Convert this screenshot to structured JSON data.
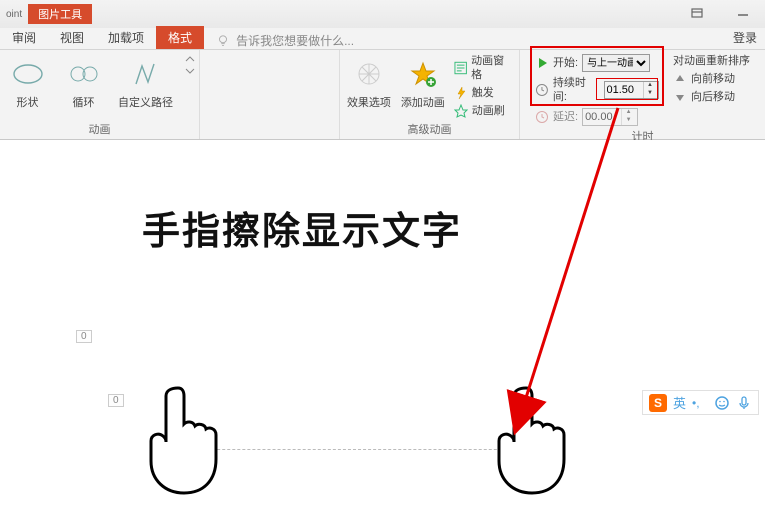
{
  "app_name": "oint",
  "context_tab_label": "图片工具",
  "tabs": {
    "review": "审阅",
    "view": "视图",
    "addins": "加载项",
    "format": "格式"
  },
  "tell_me": "告诉我您想要做什么...",
  "login": "登录",
  "groups": {
    "animation": {
      "label": "动画",
      "shape": "形状",
      "cycle": "循环",
      "custom_path": "自定义路径"
    },
    "advanced": {
      "label": "高级动画",
      "effect_options": "效果选项",
      "add_animation": "添加动画",
      "pane": "动画窗格",
      "trigger": "触发",
      "painter": "动画刷"
    },
    "timing": {
      "label": "计时",
      "start_label": "开始:",
      "start_value": "与上一动画...",
      "duration_label": "持续时间:",
      "duration_value": "01.50",
      "delay_label": "延迟:",
      "delay_value": "00.00",
      "reorder": "对动画重新排序",
      "move_fwd": "向前移动",
      "move_back": "向后移动"
    }
  },
  "slide": {
    "tag0": "0",
    "tag1": "0",
    "headline": "手指擦除显示文字"
  },
  "ime": {
    "lang": "英"
  }
}
